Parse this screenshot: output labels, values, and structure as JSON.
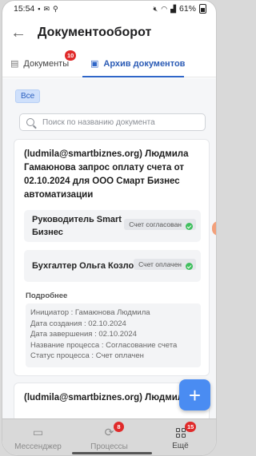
{
  "statusbar": {
    "time": "15:54",
    "battery": "61%"
  },
  "header": {
    "title": "Документооборот"
  },
  "tabs": [
    {
      "label": "Документы",
      "badge": "10"
    },
    {
      "label": "Архив документов"
    }
  ],
  "filter": {
    "chip": "Все"
  },
  "search": {
    "placeholder": "Поиск по названию документа"
  },
  "cards": [
    {
      "title": "(ludmila@smartbiznes.org) Людмила Гамаюнова запрос оплату счета от 02.10.2024 для ООО Смарт Бизнес автоматизации",
      "steps": [
        {
          "name": "Руководитель Smart Бизнес",
          "status": "Счет согласован"
        },
        {
          "name": "Бухгалтер Ольга Козлова",
          "status": "Счет оплачен"
        }
      ],
      "more_label": "Подробнее",
      "details": [
        "Инициатор : Гамаюнова Людмила",
        "Дата создания : 02.10.2024",
        "Дата завершения : 02.10.2024",
        "Название процесса : Согласование счета",
        "Статус процесса : Счет оплачен"
      ]
    },
    {
      "title": "(ludmila@smartbiznes.org) Людмила"
    }
  ],
  "bottom_nav": [
    {
      "label": "Мессенджер",
      "icon": "chat-icon"
    },
    {
      "label": "Процессы",
      "icon": "process-icon",
      "badge": "8"
    },
    {
      "label": "Ещё",
      "icon": "grid-icon",
      "badge": "15"
    }
  ],
  "colors": {
    "accent": "#2f66c8",
    "badge": "#e02a2a",
    "fab": "#4a8cf2",
    "ok": "#3fbf5e"
  }
}
